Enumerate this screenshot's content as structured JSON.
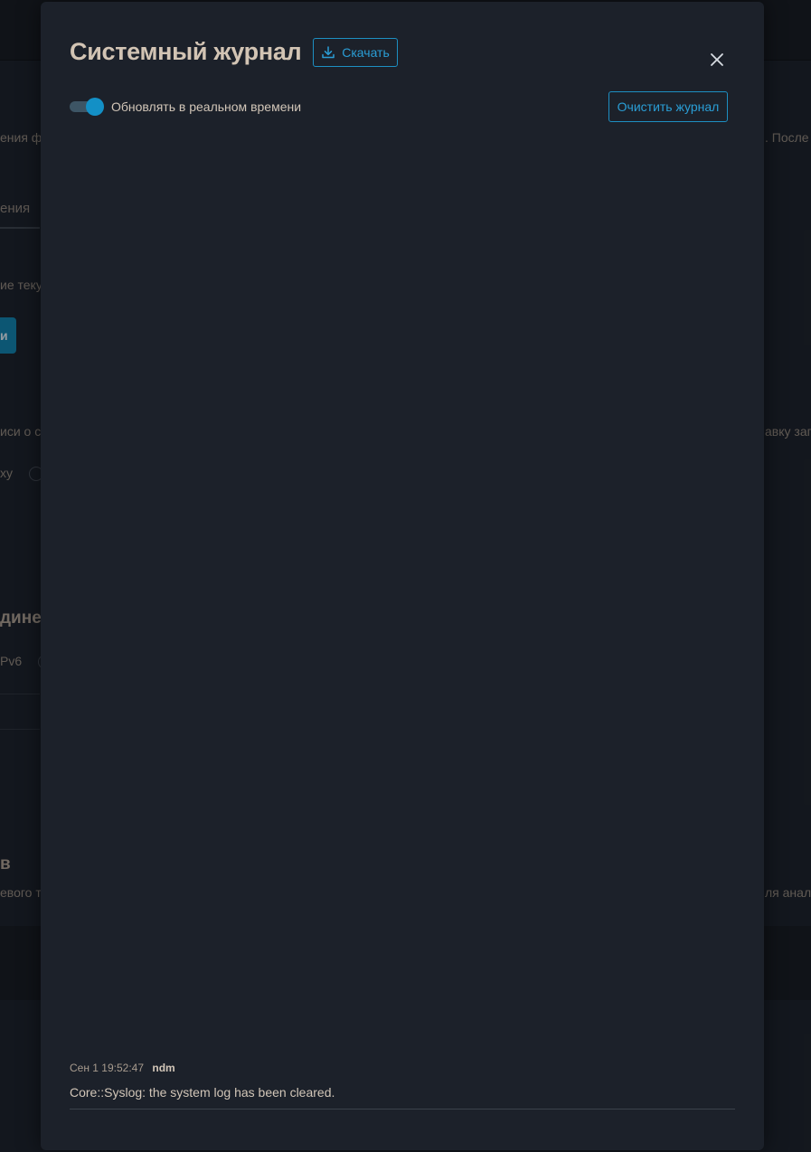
{
  "background": {
    "fragments": {
      "f1": "ения ф",
      "f2": ". После у",
      "f3": "ения",
      "f4": "ие теку",
      "f5": "и",
      "f6": "иси о с",
      "f7": "авку зап",
      "f8": "ху",
      "f9": "дине",
      "f10": "Pv6",
      "f11": "в",
      "f12": "евого тр",
      "f13": "ля анали"
    }
  },
  "modal": {
    "title": "Системный журнал",
    "download_label": "Скачать",
    "realtime_label": "Обновлять в реальном времени",
    "realtime_on": true,
    "clear_label": "Очистить журнал",
    "accent_color": "#1d8fc2"
  },
  "log": {
    "entries": [
      {
        "time": "Сен 1 19:52:47",
        "source": "ndm",
        "message": "Core::Syslog: the system log has been cleared."
      }
    ]
  }
}
